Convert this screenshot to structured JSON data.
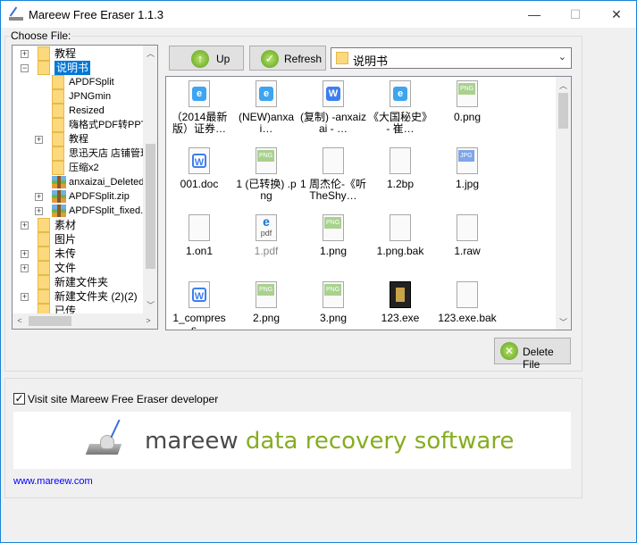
{
  "window": {
    "title": "Mareew Free Eraser 1.1.3",
    "minimize": "—",
    "maximize": "☐",
    "close": "✕"
  },
  "group_label": "Choose File:",
  "tree": [
    {
      "label": "教程",
      "level": 0,
      "exp": "+",
      "icon": "folder"
    },
    {
      "label": "说明书",
      "level": 0,
      "exp": "-",
      "icon": "folder",
      "selected": true
    },
    {
      "label": "APDFSplit",
      "level": 1,
      "exp": "",
      "icon": "folder"
    },
    {
      "label": "JPNGmin",
      "level": 1,
      "exp": "",
      "icon": "folder"
    },
    {
      "label": "Resized",
      "level": 1,
      "exp": "",
      "icon": "folder"
    },
    {
      "label": "嗨格式PDF转PPT",
      "level": 1,
      "exp": "",
      "icon": "folder"
    },
    {
      "label": "教程",
      "level": 1,
      "exp": "+",
      "icon": "folder"
    },
    {
      "label": "思迅天店 店铺管理",
      "level": 1,
      "exp": "",
      "icon": "folder"
    },
    {
      "label": "压缩x2",
      "level": 1,
      "exp": "",
      "icon": "folder"
    },
    {
      "label": "anxaizai_Deleted.zip",
      "level": 1,
      "exp": "",
      "icon": "zip"
    },
    {
      "label": "APDFSplit.zip",
      "level": 1,
      "exp": "+",
      "icon": "zip"
    },
    {
      "label": "APDFSplit_fixed.zip",
      "level": 1,
      "exp": "+",
      "icon": "zip"
    },
    {
      "label": "素材",
      "level": 0,
      "exp": "+",
      "icon": "folder"
    },
    {
      "label": "图片",
      "level": 0,
      "exp": "",
      "icon": "folder"
    },
    {
      "label": "未传",
      "level": 0,
      "exp": "+",
      "icon": "folder"
    },
    {
      "label": "文件",
      "level": 0,
      "exp": "+",
      "icon": "folder"
    },
    {
      "label": "新建文件夹",
      "level": 0,
      "exp": "",
      "icon": "folder"
    },
    {
      "label": "新建文件夹 (2)(2)",
      "level": 0,
      "exp": "+",
      "icon": "folder"
    },
    {
      "label": "已传",
      "level": 0,
      "exp": "",
      "icon": "folder"
    }
  ],
  "toolbar": {
    "up": "Up",
    "refresh": "Refresh",
    "path": "说明书"
  },
  "files": [
    {
      "name": "（2014最新版）证券…",
      "icon": "e"
    },
    {
      "name": "(NEW)anxai…",
      "icon": "e"
    },
    {
      "name": "(复制) -anxaizai - …",
      "icon": "w"
    },
    {
      "name": "《大国秘史》 - 崔…",
      "icon": "e"
    },
    {
      "name": "0.png",
      "icon": "png"
    },
    {
      "name": "001.doc",
      "icon": "doc"
    },
    {
      "name": "1 (已转换) .png",
      "icon": "png"
    },
    {
      "name": "1 周杰伦-《听TheShy…",
      "icon": "blank"
    },
    {
      "name": "1.2bp",
      "icon": "blank"
    },
    {
      "name": "1.jpg",
      "icon": "jpg"
    },
    {
      "name": "1.on1",
      "icon": "blank"
    },
    {
      "name": "1.pdf",
      "icon": "pdf"
    },
    {
      "name": "1.png",
      "icon": "png"
    },
    {
      "name": "1.png.bak",
      "icon": "blank"
    },
    {
      "name": "1.raw",
      "icon": "blank"
    },
    {
      "name": "1_compress…",
      "icon": "doc"
    },
    {
      "name": "2.png",
      "icon": "png"
    },
    {
      "name": "3.png",
      "icon": "png"
    },
    {
      "name": "123.exe",
      "icon": "exe"
    },
    {
      "name": "123.exe.bak",
      "icon": "blank"
    }
  ],
  "delete_label": "Delete File",
  "visit_label": "Visit site Mareew Free Eraser developer",
  "visit_checked": true,
  "banner": {
    "brand": "mareew",
    "tagline": "data recovery software"
  },
  "link": "www.mareew.com",
  "colors": {
    "accent": "#0078d7",
    "green": "#86ad1f",
    "link": "#0000ff"
  }
}
